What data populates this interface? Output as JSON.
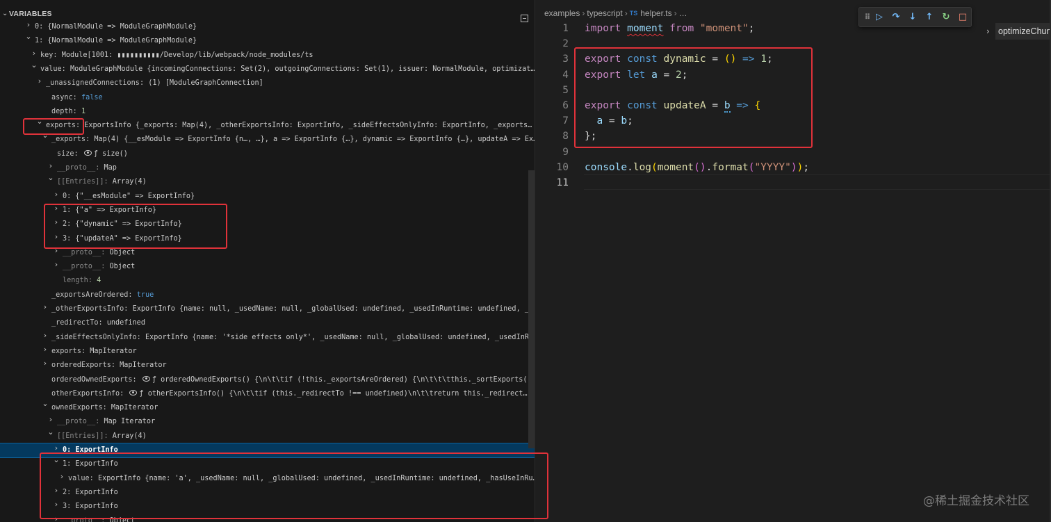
{
  "variables": {
    "header": "VARIABLES",
    "rows": [
      {
        "t": "e",
        "k": "0",
        "v": "{NormalModule => ModuleGraphModule}"
      },
      {
        "t": "e",
        "k": "1",
        "v": "{NormalModule => ModuleGraphModule}"
      },
      {
        "t": "p",
        "k": "key",
        "v": "Module[1001: ▮▮▮▮▮▮▮▮▮▮/Develop/lib/webpack/node_modules/ts"
      },
      {
        "t": "p",
        "k": "value",
        "v": "ModuleGraphModule {incomingConnections: Set(2), outgoingConnections: Set(1), issuer: NormalModule, optimizat…"
      },
      {
        "t": "p",
        "k": "_unassignedConnections",
        "v": "(1) [ModuleGraphConnection]"
      },
      {
        "t": "p",
        "k": "async",
        "v": "false"
      },
      {
        "t": "p",
        "k": "depth",
        "v": "1"
      },
      {
        "t": "p",
        "k": "exports",
        "v": "ExportsInfo {_exports: Map(4), _otherExportsInfo: ExportInfo, _sideEffectsOnlyInfo: ExportInfo, _exports…"
      },
      {
        "t": "p",
        "k": "_exports",
        "v": "Map(4) {__esModule => ExportInfo {n…, …}, a => ExportInfo {…}, dynamic => ExportInfo {…}, updateA => Ex…"
      },
      {
        "t": "p",
        "k": "size",
        "v": "ƒ size()"
      },
      {
        "t": "d",
        "k": "__proto__",
        "v": "Map"
      },
      {
        "t": "d",
        "k": "[[Entries]]",
        "v": "Array(4)"
      },
      {
        "t": "e",
        "k": "0",
        "v": "{\"__esModule\" => ExportInfo}"
      },
      {
        "t": "e",
        "k": "1",
        "v": "{\"a\" => ExportInfo}"
      },
      {
        "t": "e",
        "k": "2",
        "v": "{\"dynamic\" => ExportInfo}"
      },
      {
        "t": "e",
        "k": "3",
        "v": "{\"updateA\" => ExportInfo}"
      },
      {
        "t": "d",
        "k": "__proto__",
        "v": "Object"
      },
      {
        "t": "d",
        "k": "__proto__",
        "v": "Object"
      },
      {
        "t": "d",
        "k": "length",
        "v": "4"
      },
      {
        "t": "p",
        "k": "_exportsAreOrdered",
        "v": "true"
      },
      {
        "t": "p",
        "k": "_otherExportsInfo",
        "v": "ExportInfo {name: null, _usedName: null, _globalUsed: undefined, _usedInRuntime: undefined, _h…"
      },
      {
        "t": "p",
        "k": "_redirectTo",
        "v": "undefined"
      },
      {
        "t": "p",
        "k": "_sideEffectsOnlyInfo",
        "v": "ExportInfo {name: '*side effects only*', _usedName: null, _globalUsed: undefined, _usedInRu…"
      },
      {
        "t": "p",
        "k": "exports",
        "v": "MapIterator"
      },
      {
        "t": "p",
        "k": "orderedExports",
        "v": "MapIterator"
      },
      {
        "t": "p",
        "k": "orderedOwnedExports",
        "v": "ƒ orderedOwnedExports() {\\n\\t\\tif (!this._exportsAreOrdered) {\\n\\t\\t\\tthis._sortExports()…"
      },
      {
        "t": "p",
        "k": "otherExportsInfo",
        "v": "ƒ otherExportsInfo() {\\n\\t\\tif (this._redirectTo !== undefined)\\n\\t\\treturn this._redirect…"
      },
      {
        "t": "p",
        "k": "ownedExports",
        "v": "MapIterator"
      },
      {
        "t": "d",
        "k": "__proto__",
        "v": "Map Iterator"
      },
      {
        "t": "d",
        "k": "[[Entries]]",
        "v": "Array(4)"
      },
      {
        "t": "e",
        "k": "0",
        "v": "ExportInfo"
      },
      {
        "t": "e",
        "k": "1",
        "v": "ExportInfo"
      },
      {
        "t": "p",
        "k": "value",
        "v": "ExportInfo {name: 'a', _usedName: null, _globalUsed: undefined, _usedInRuntime: undefined, _hasUseInRu…"
      },
      {
        "t": "e",
        "k": "2",
        "v": "ExportInfo"
      },
      {
        "t": "e",
        "k": "3",
        "v": "ExportInfo"
      },
      {
        "t": "d",
        "k": "__proto__",
        "v": "Object"
      }
    ]
  },
  "editor": {
    "breadcrumb": [
      "examples",
      "typescript",
      "helper.ts",
      "…"
    ],
    "file_badge": "TS",
    "side_item": "optimizeChun",
    "code_lines": [
      "import moment from \"moment\";",
      "",
      "export const dynamic = () => 1;",
      "export let a = 2;",
      "",
      "export const updateA = b => {",
      "  a = b;",
      "};",
      "",
      "console.log(moment().format(\"YYYY\"));",
      ""
    ],
    "line_numbers": [
      "1",
      "2",
      "3",
      "4",
      "5",
      "6",
      "7",
      "8",
      "9",
      "10",
      "11"
    ]
  },
  "debug_toolbar": [
    "drag-handle-icon",
    "continue-icon",
    "step-over-icon",
    "step-into-icon",
    "step-out-icon",
    "restart-icon",
    "stop-icon"
  ],
  "watermark": "@稀土掘金技术社区",
  "colors": {
    "highlight_box": "#e0323a",
    "selected_row": "#04395e",
    "keyword": "#569cd6",
    "string": "#ce9178"
  }
}
